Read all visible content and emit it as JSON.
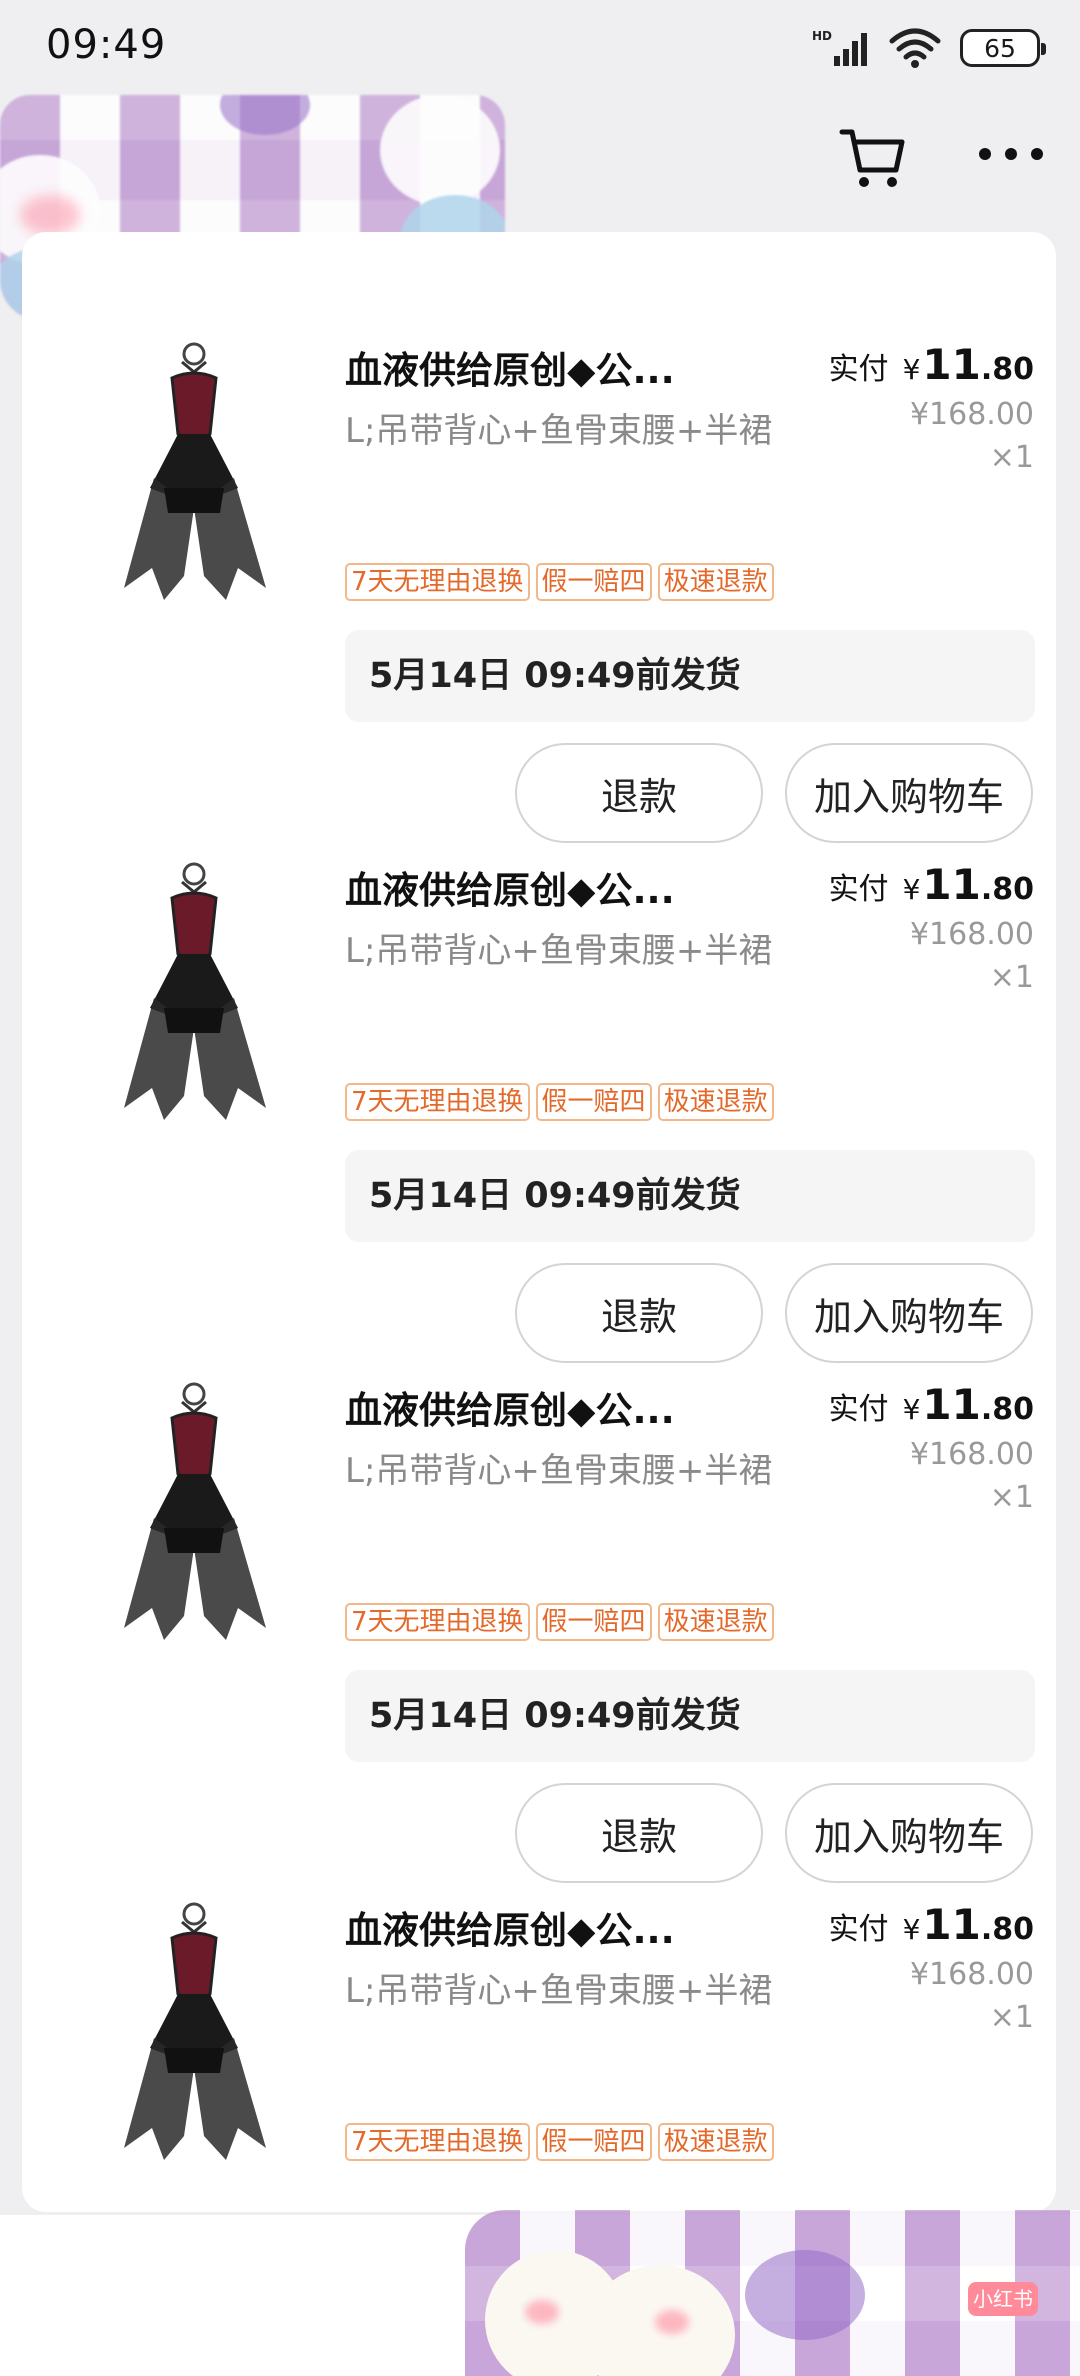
{
  "status_bar": {
    "time": "09:49",
    "network": "HD",
    "battery": "65"
  },
  "header": {
    "cart_icon": "shopping-cart-icon",
    "more_icon": "more-dots-icon"
  },
  "items": [
    {
      "title": "血液供给原创◆公...",
      "spec": "L;吊带背心+鱼骨束腰+半裙",
      "tags": [
        "7天无理由退换",
        "假一赔四",
        "极速退款"
      ],
      "paid_label": "实付",
      "currency": "¥",
      "price_int": "11",
      "price_dec": ".80",
      "original_price": "¥168.00",
      "quantity": "×1",
      "ship_text": "5月14日 09:49前发货",
      "refund_label": "退款",
      "add_cart_label": "加入购物车"
    },
    {
      "title": "血液供给原创◆公...",
      "spec": "L;吊带背心+鱼骨束腰+半裙",
      "tags": [
        "7天无理由退换",
        "假一赔四",
        "极速退款"
      ],
      "paid_label": "实付",
      "currency": "¥",
      "price_int": "11",
      "price_dec": ".80",
      "original_price": "¥168.00",
      "quantity": "×1",
      "ship_text": "5月14日 09:49前发货",
      "refund_label": "退款",
      "add_cart_label": "加入购物车"
    },
    {
      "title": "血液供给原创◆公...",
      "spec": "L;吊带背心+鱼骨束腰+半裙",
      "tags": [
        "7天无理由退换",
        "假一赔四",
        "极速退款"
      ],
      "paid_label": "实付",
      "currency": "¥",
      "price_int": "11",
      "price_dec": ".80",
      "original_price": "¥168.00",
      "quantity": "×1",
      "ship_text": "5月14日 09:49前发货",
      "refund_label": "退款",
      "add_cart_label": "加入购物车"
    },
    {
      "title": "血液供给原创◆公...",
      "spec": "L;吊带背心+鱼骨束腰+半裙",
      "tags": [
        "7天无理由退换",
        "假一赔四",
        "极速退款"
      ],
      "paid_label": "实付",
      "currency": "¥",
      "price_int": "11",
      "price_dec": ".80",
      "original_price": "¥168.00",
      "quantity": "×1"
    }
  ],
  "watermark": {
    "logo": "小红书"
  },
  "colors": {
    "tag_text": "#e46a2b",
    "tag_border": "#f2b88a",
    "background": "#efeff1"
  }
}
